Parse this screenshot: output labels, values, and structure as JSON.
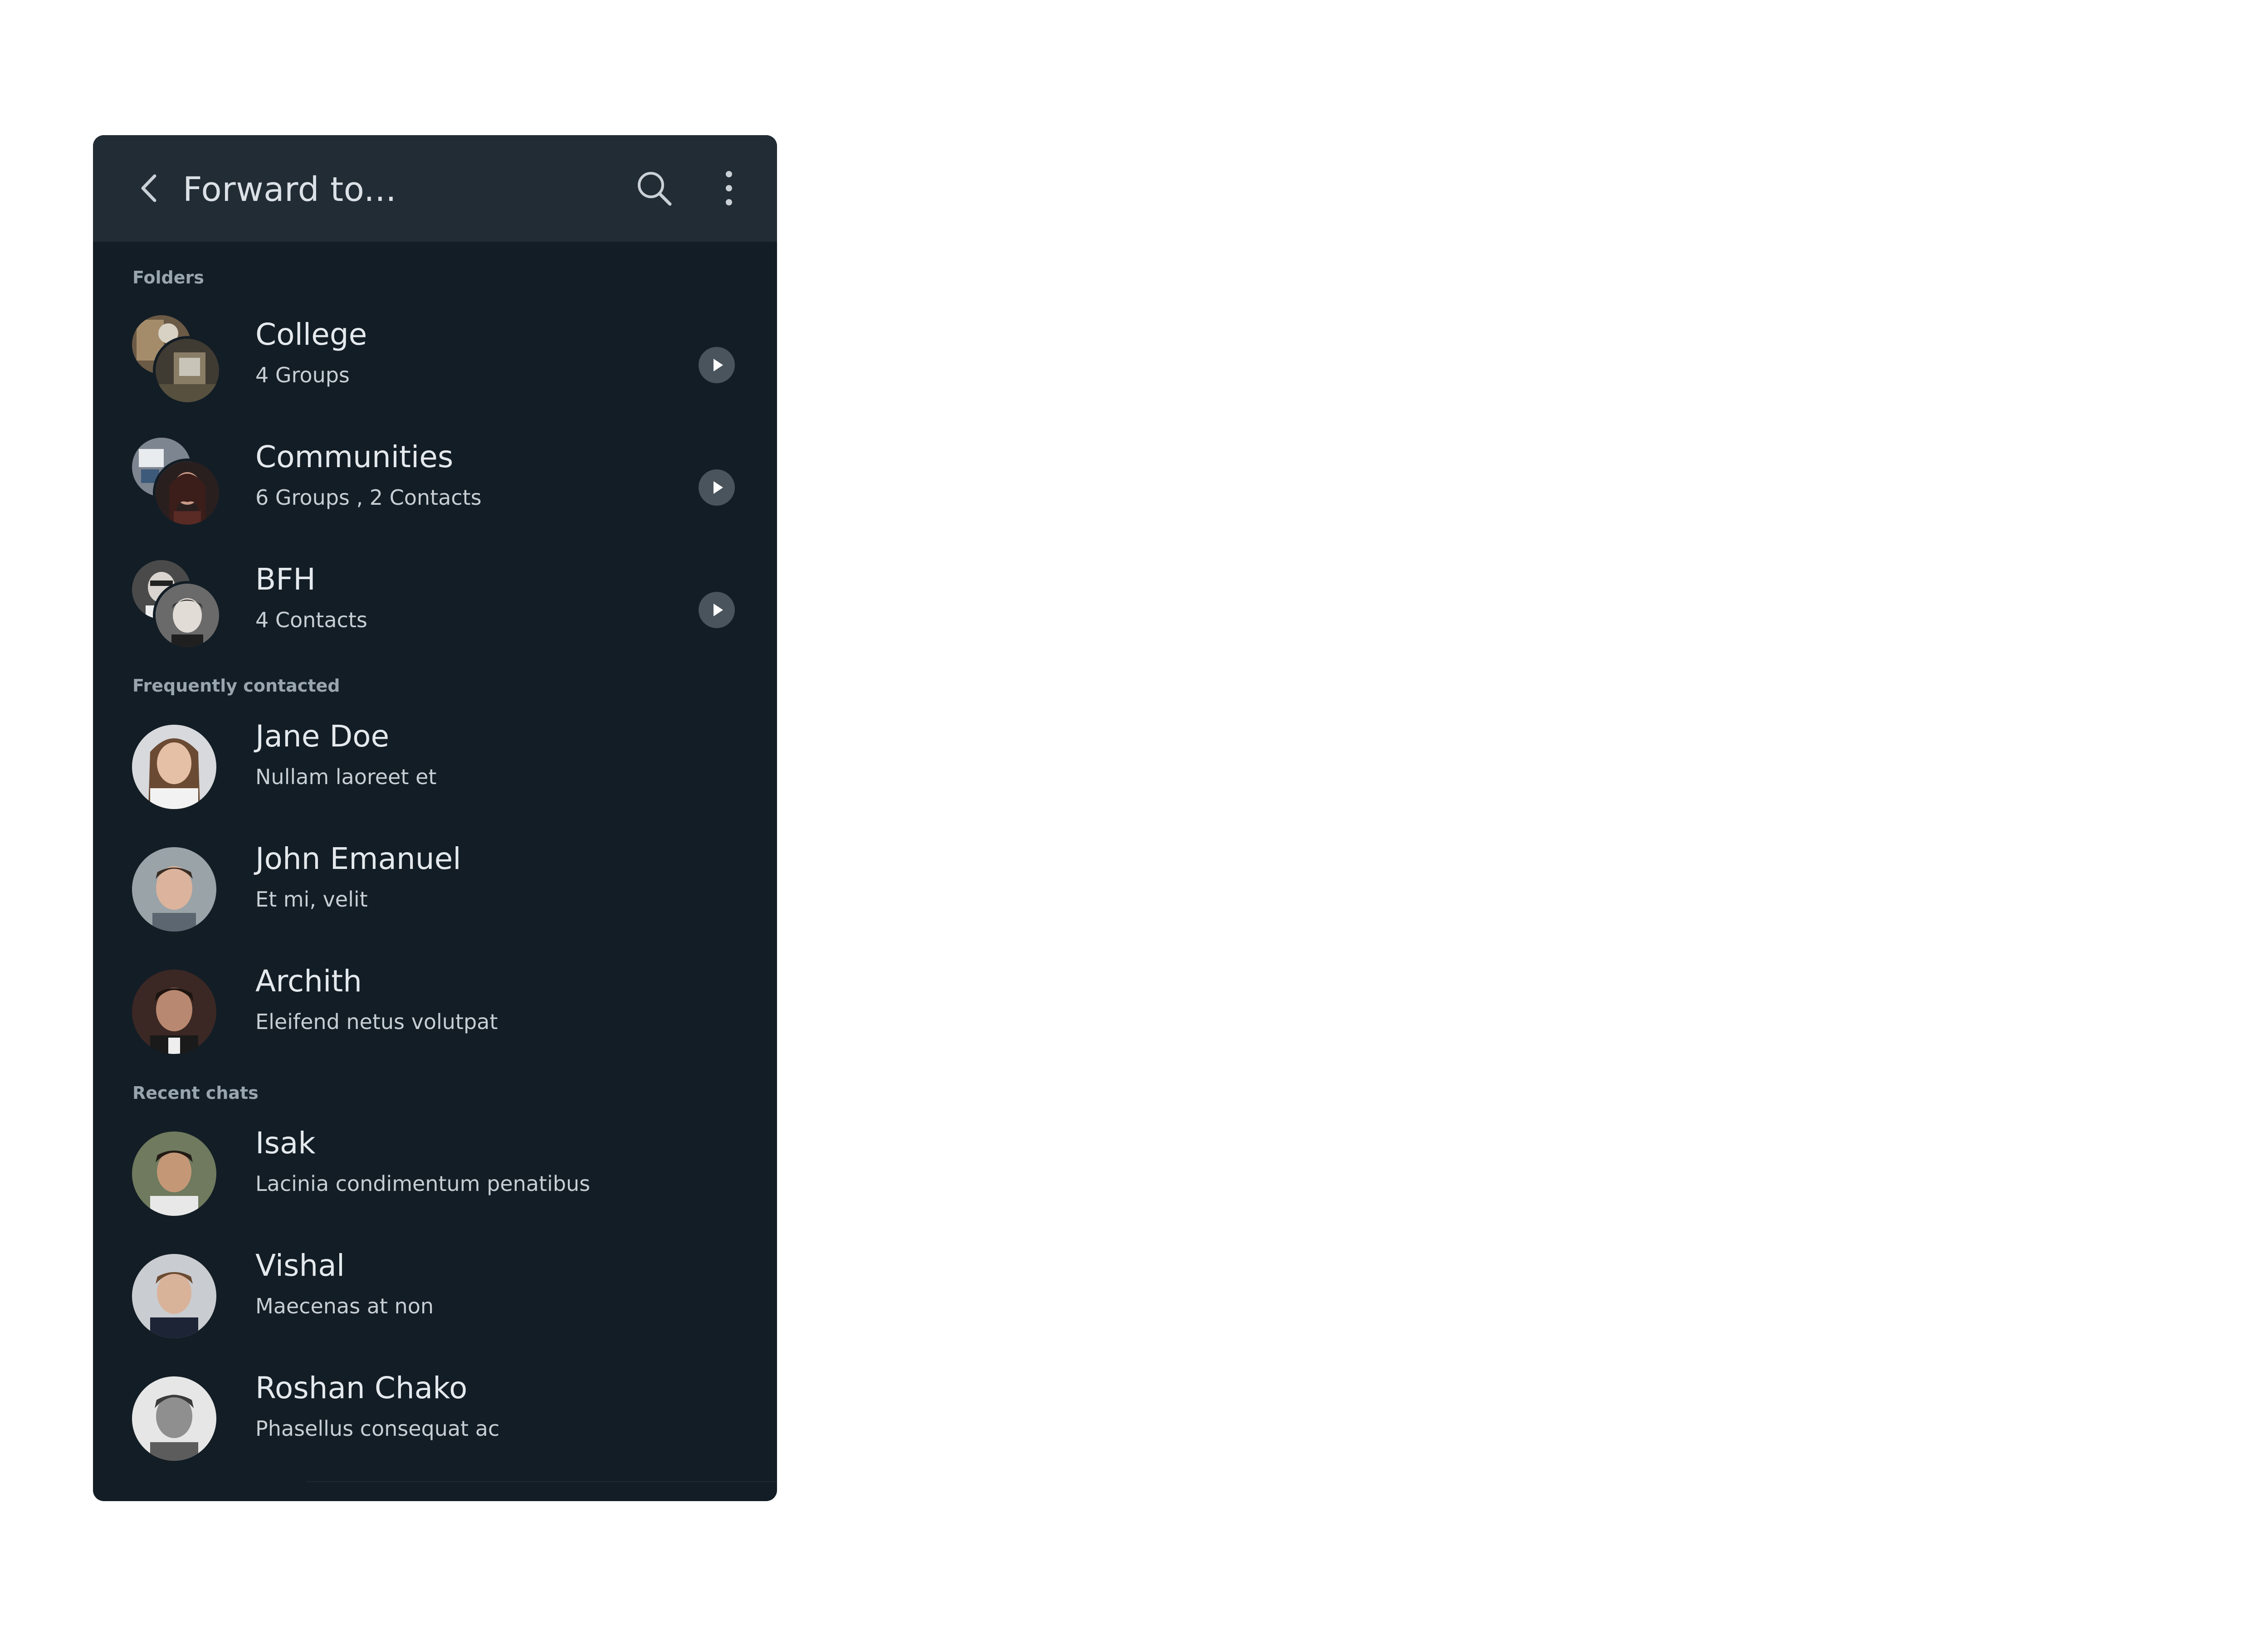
{
  "header": {
    "title": "Forward to..."
  },
  "sections": {
    "folders_label": "Folders",
    "frequent_label": "Frequently contacted",
    "recent_label": "Recent chats"
  },
  "folders": [
    {
      "name": "College",
      "subtitle": "4 Groups"
    },
    {
      "name": "Communities",
      "subtitle": "6 Groups , 2 Contacts"
    },
    {
      "name": "BFH",
      "subtitle": "4 Contacts"
    }
  ],
  "frequent": [
    {
      "name": "Jane Doe",
      "subtitle": "Nullam laoreet et"
    },
    {
      "name": "John Emanuel",
      "subtitle": "Et mi, velit"
    },
    {
      "name": "Archith",
      "subtitle": "Eleifend netus volutpat"
    }
  ],
  "recent": [
    {
      "name": "Isak",
      "subtitle": "Lacinia condimentum penatibus"
    },
    {
      "name": "Vishal",
      "subtitle": "Maecenas at non"
    },
    {
      "name": "Roshan Chako",
      "subtitle": "Phasellus consequat ac"
    }
  ],
  "colors": {
    "background": "#131d25",
    "appbar": "#222c35",
    "primary_text": "#e4e9ed",
    "secondary_text": "#c7ced4",
    "section_label": "#98a4ae"
  },
  "icons": {
    "back": "back-arrow-icon",
    "search": "search-icon",
    "more": "more-vertical-icon",
    "folder_open": "play-chevron-icon"
  }
}
